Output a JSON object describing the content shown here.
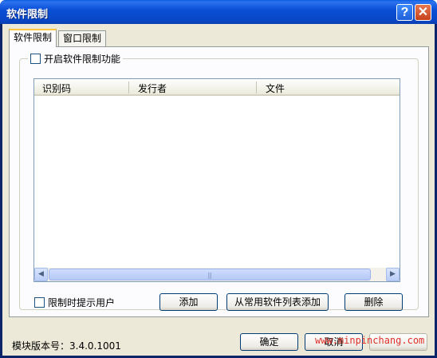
{
  "window": {
    "title": "软件限制"
  },
  "tabs": [
    {
      "label": "软件限制"
    },
    {
      "label": "窗口限制"
    }
  ],
  "group": {
    "enable_label": "开启软件限制功能",
    "enabled": false
  },
  "list": {
    "columns": [
      "识别码",
      "发行者",
      "文件"
    ],
    "rows": []
  },
  "notify": {
    "label": "限制时提示用户",
    "checked": false
  },
  "actions": {
    "add": "添加",
    "add_from_common": "从常用软件列表添加",
    "delete": "删除"
  },
  "footer": {
    "version": "模块版本号：3.4.0.1001",
    "ok": "确定",
    "cancel": "取消",
    "watermark": "www.minpinchang.com"
  },
  "icons": {
    "help": "help-icon",
    "close": "close-icon",
    "scroll_left": "arrow-left-icon",
    "scroll_right": "arrow-right-icon"
  },
  "colors": {
    "titlebar": "#0a4fd6",
    "client": "#ece9d8",
    "active_tab_accent": "#ffc83c",
    "watermark": "#e0312a"
  }
}
